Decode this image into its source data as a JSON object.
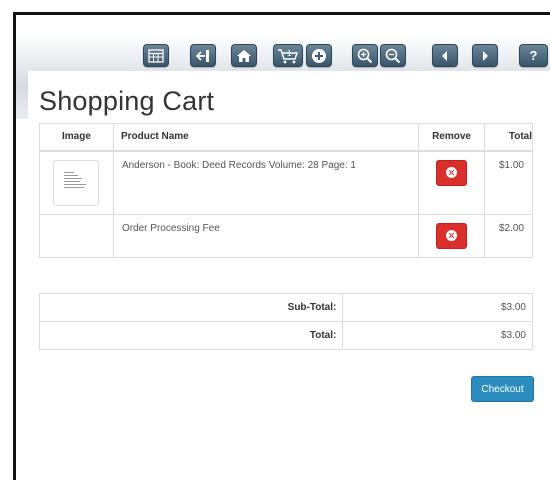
{
  "toolbar": {
    "buttons": [
      {
        "name": "spreadsheet-icon"
      },
      {
        "name": "exit-icon"
      },
      {
        "name": "home-icon"
      },
      {
        "name": "cart-count-icon",
        "label": "1"
      },
      {
        "name": "add-circle-icon"
      },
      {
        "name": "zoom-in-icon"
      },
      {
        "name": "zoom-out-icon"
      },
      {
        "name": "previous-page-icon"
      },
      {
        "name": "next-page-icon"
      },
      {
        "name": "help-icon",
        "label": "?"
      }
    ]
  },
  "page": {
    "title": "Shopping Cart"
  },
  "cart": {
    "headers": {
      "image": "Image",
      "product": "Product Name",
      "remove": "Remove",
      "total": "Total"
    },
    "rows": [
      {
        "product": "Anderson - Book: Deed Records Volume: 28 Page: 1",
        "total": "$1.00",
        "has_image": true
      },
      {
        "product": "Order Processing Fee",
        "total": "$2.00",
        "has_image": false
      }
    ]
  },
  "totals": {
    "subtotal_label": "Sub-Total:",
    "subtotal_value": "$3.00",
    "total_label": "Total:",
    "total_value": "$3.00"
  },
  "checkout": {
    "label": "Checkout"
  },
  "colors": {
    "toolbar_button": "#4b6a80",
    "remove_button": "#d9302c",
    "checkout_button": "#2a8cbf"
  }
}
